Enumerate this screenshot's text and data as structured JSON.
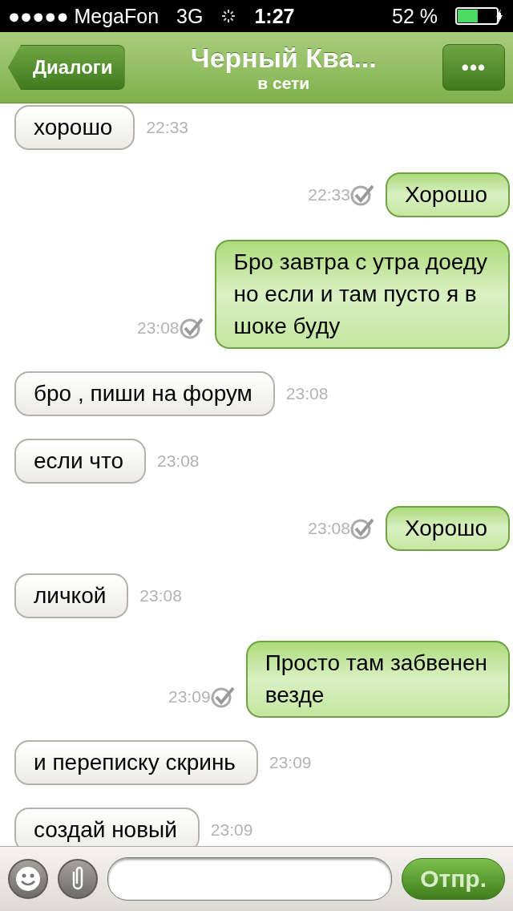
{
  "status_bar": {
    "carrier": "●●●●● MegaFon",
    "network": "3G",
    "time": "1:27",
    "battery_text": "52 %",
    "battery": {
      "level": 0.52
    }
  },
  "nav": {
    "back": "Диалоги",
    "title": "Черный Ква...",
    "subtitle": "в сети",
    "menu": "•••"
  },
  "messages": [
    {
      "kind": "incoming",
      "text": "хорошо",
      "time": "22:33"
    },
    {
      "kind": "outgoing",
      "text": "Хорошо",
      "time": "22:33"
    },
    {
      "kind": "outgoing",
      "text": "Бро завтра с утра доеду\nно если и там пусто я в\nшоке буду",
      "time": "23:08"
    },
    {
      "kind": "incoming",
      "text": "бро , пиши на форум",
      "time": "23:08"
    },
    {
      "kind": "incoming",
      "text": "если что",
      "time": "23:08"
    },
    {
      "kind": "outgoing",
      "text": "Хорошо",
      "time": "23:08"
    },
    {
      "kind": "incoming",
      "text": "личкой",
      "time": "23:08"
    },
    {
      "kind": "outgoing",
      "text": "Просто там забвенен\nвезде",
      "time": "23:09"
    },
    {
      "kind": "incoming",
      "text": "и переписку скринь",
      "time": "23:09"
    },
    {
      "kind": "incoming",
      "text": "создай новый",
      "time": "23:09"
    }
  ],
  "composer": {
    "send": "Отпр."
  }
}
